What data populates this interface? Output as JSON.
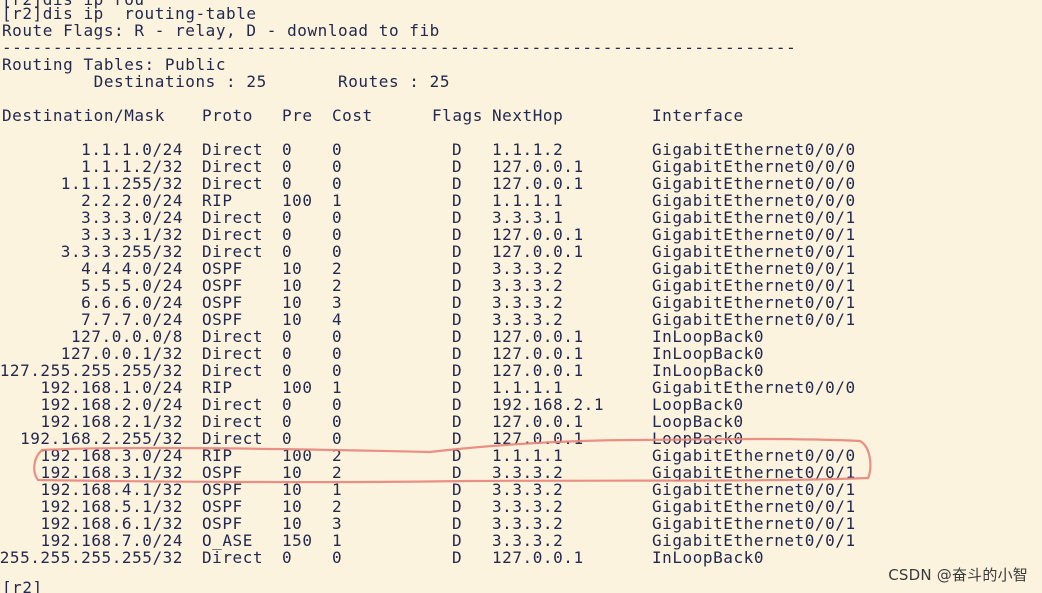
{
  "terminal": {
    "lines": {
      "partial_top": "[r2]dis ip rou",
      "command": "[r2]dis ip  routing-table",
      "flags_legend": "Route Flags: R - relay, D - download to fib",
      "separator": "------------------------------------------------------------------------------",
      "tables_title": "Routing Tables: Public",
      "counts": "         Destinations : 25       Routes : 25",
      "prompt_bottom": "[r2]"
    },
    "header": {
      "destination": "Destination/Mask",
      "proto": "Proto",
      "pre": "Pre",
      "cost": "Cost",
      "flags": "Flags",
      "nexthop": "NextHop",
      "interface": "Interface"
    },
    "routes": [
      {
        "dest": "1.1.1.0/24",
        "proto": "Direct",
        "pre": "0",
        "cost": "0",
        "flags": "D",
        "nexthop": "1.1.1.2",
        "iface": "GigabitEthernet0/0/0"
      },
      {
        "dest": "1.1.1.2/32",
        "proto": "Direct",
        "pre": "0",
        "cost": "0",
        "flags": "D",
        "nexthop": "127.0.0.1",
        "iface": "GigabitEthernet0/0/0"
      },
      {
        "dest": "1.1.1.255/32",
        "proto": "Direct",
        "pre": "0",
        "cost": "0",
        "flags": "D",
        "nexthop": "127.0.0.1",
        "iface": "GigabitEthernet0/0/0"
      },
      {
        "dest": "2.2.2.0/24",
        "proto": "RIP",
        "pre": "100",
        "cost": "1",
        "flags": "D",
        "nexthop": "1.1.1.1",
        "iface": "GigabitEthernet0/0/0"
      },
      {
        "dest": "3.3.3.0/24",
        "proto": "Direct",
        "pre": "0",
        "cost": "0",
        "flags": "D",
        "nexthop": "3.3.3.1",
        "iface": "GigabitEthernet0/0/1"
      },
      {
        "dest": "3.3.3.1/32",
        "proto": "Direct",
        "pre": "0",
        "cost": "0",
        "flags": "D",
        "nexthop": "127.0.0.1",
        "iface": "GigabitEthernet0/0/1"
      },
      {
        "dest": "3.3.3.255/32",
        "proto": "Direct",
        "pre": "0",
        "cost": "0",
        "flags": "D",
        "nexthop": "127.0.0.1",
        "iface": "GigabitEthernet0/0/1"
      },
      {
        "dest": "4.4.4.0/24",
        "proto": "OSPF",
        "pre": "10",
        "cost": "2",
        "flags": "D",
        "nexthop": "3.3.3.2",
        "iface": "GigabitEthernet0/0/1"
      },
      {
        "dest": "5.5.5.0/24",
        "proto": "OSPF",
        "pre": "10",
        "cost": "2",
        "flags": "D",
        "nexthop": "3.3.3.2",
        "iface": "GigabitEthernet0/0/1"
      },
      {
        "dest": "6.6.6.0/24",
        "proto": "OSPF",
        "pre": "10",
        "cost": "3",
        "flags": "D",
        "nexthop": "3.3.3.2",
        "iface": "GigabitEthernet0/0/1"
      },
      {
        "dest": "7.7.7.0/24",
        "proto": "OSPF",
        "pre": "10",
        "cost": "4",
        "flags": "D",
        "nexthop": "3.3.3.2",
        "iface": "GigabitEthernet0/0/1"
      },
      {
        "dest": "127.0.0.0/8",
        "proto": "Direct",
        "pre": "0",
        "cost": "0",
        "flags": "D",
        "nexthop": "127.0.0.1",
        "iface": "InLoopBack0"
      },
      {
        "dest": "127.0.0.1/32",
        "proto": "Direct",
        "pre": "0",
        "cost": "0",
        "flags": "D",
        "nexthop": "127.0.0.1",
        "iface": "InLoopBack0"
      },
      {
        "dest": "127.255.255.255/32",
        "proto": "Direct",
        "pre": "0",
        "cost": "0",
        "flags": "D",
        "nexthop": "127.0.0.1",
        "iface": "InLoopBack0"
      },
      {
        "dest": "192.168.1.0/24",
        "proto": "RIP",
        "pre": "100",
        "cost": "1",
        "flags": "D",
        "nexthop": "1.1.1.1",
        "iface": "GigabitEthernet0/0/0"
      },
      {
        "dest": "192.168.2.0/24",
        "proto": "Direct",
        "pre": "0",
        "cost": "0",
        "flags": "D",
        "nexthop": "192.168.2.1",
        "iface": "LoopBack0"
      },
      {
        "dest": "192.168.2.1/32",
        "proto": "Direct",
        "pre": "0",
        "cost": "0",
        "flags": "D",
        "nexthop": "127.0.0.1",
        "iface": "LoopBack0"
      },
      {
        "dest": "192.168.2.255/32",
        "proto": "Direct",
        "pre": "0",
        "cost": "0",
        "flags": "D",
        "nexthop": "127.0.0.1",
        "iface": "LoopBack0"
      },
      {
        "dest": "192.168.3.0/24",
        "proto": "RIP",
        "pre": "100",
        "cost": "2",
        "flags": "D",
        "nexthop": "1.1.1.1",
        "iface": "GigabitEthernet0/0/0",
        "highlighted": true
      },
      {
        "dest": "192.168.3.1/32",
        "proto": "OSPF",
        "pre": "10",
        "cost": "2",
        "flags": "D",
        "nexthop": "3.3.3.2",
        "iface": "GigabitEthernet0/0/1",
        "highlighted": true
      },
      {
        "dest": "192.168.4.1/32",
        "proto": "OSPF",
        "pre": "10",
        "cost": "1",
        "flags": "D",
        "nexthop": "3.3.3.2",
        "iface": "GigabitEthernet0/0/1"
      },
      {
        "dest": "192.168.5.1/32",
        "proto": "OSPF",
        "pre": "10",
        "cost": "2",
        "flags": "D",
        "nexthop": "3.3.3.2",
        "iface": "GigabitEthernet0/0/1"
      },
      {
        "dest": "192.168.6.1/32",
        "proto": "OSPF",
        "pre": "10",
        "cost": "3",
        "flags": "D",
        "nexthop": "3.3.3.2",
        "iface": "GigabitEthernet0/0/1"
      },
      {
        "dest": "192.168.7.0/24",
        "proto": "O_ASE",
        "pre": "150",
        "cost": "1",
        "flags": "D",
        "nexthop": "3.3.3.2",
        "iface": "GigabitEthernet0/0/1"
      },
      {
        "dest": "255.255.255.255/32",
        "proto": "Direct",
        "pre": "0",
        "cost": "0",
        "flags": "D",
        "nexthop": "127.0.0.1",
        "iface": "InLoopBack0"
      }
    ]
  },
  "watermark": "CSDN @奋斗的小智",
  "colors": {
    "background": "#fbf3de",
    "text": "#22284f",
    "highlight_stroke": "#e8847a"
  }
}
